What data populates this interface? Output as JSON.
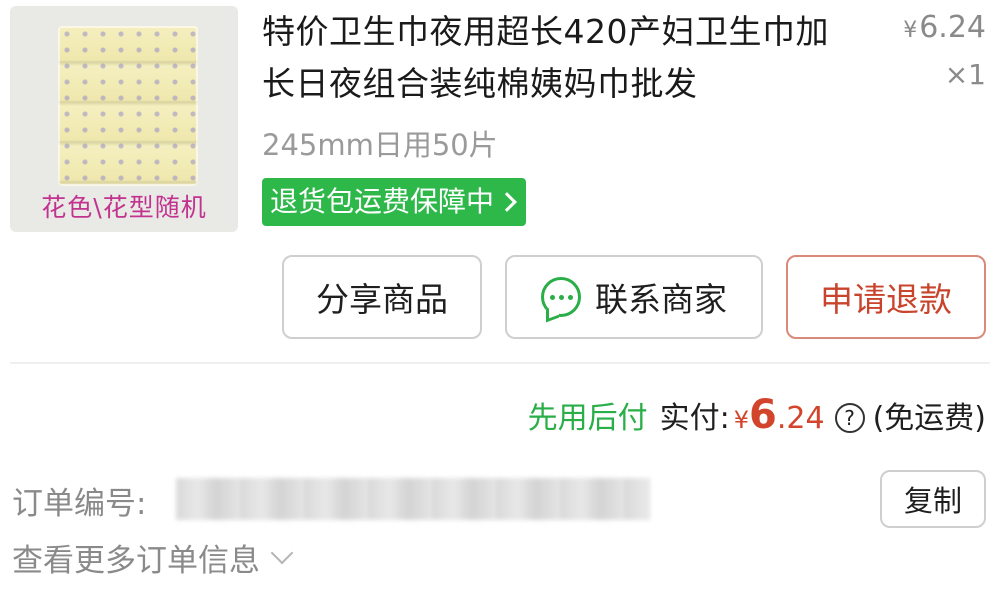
{
  "product": {
    "image_caption": "花色\\花型随机",
    "title": "特价卫生巾夜用超长420产妇卫生巾加长日夜组合装纯棉姨妈巾批发",
    "price_symbol": "¥",
    "price": "6.24",
    "quantity": "×1",
    "spec": "245mm日用50片",
    "guarantee_badge": "退货包运费保障中"
  },
  "actions": {
    "share_label": "分享商品",
    "contact_label": "联系商家",
    "refund_label": "申请退款"
  },
  "payment": {
    "pay_later": "先用后付",
    "paid_label": "实付:",
    "currency": "¥",
    "amount_int": "6",
    "amount_dec": ".24",
    "help": "?",
    "shipping_note": "(免运费)"
  },
  "order": {
    "number_label": "订单编号:",
    "copy_label": "复制",
    "more_info_label": "查看更多订单信息"
  },
  "colors": {
    "accent_green": "#2fb84a",
    "refund_red": "#c8442c",
    "price_red": "#d2452c"
  },
  "icons": {
    "contact": "chat-bubble-icon",
    "help": "question-circle-icon",
    "expand": "chevron-down-icon",
    "badge": "chevron-right-icon"
  }
}
